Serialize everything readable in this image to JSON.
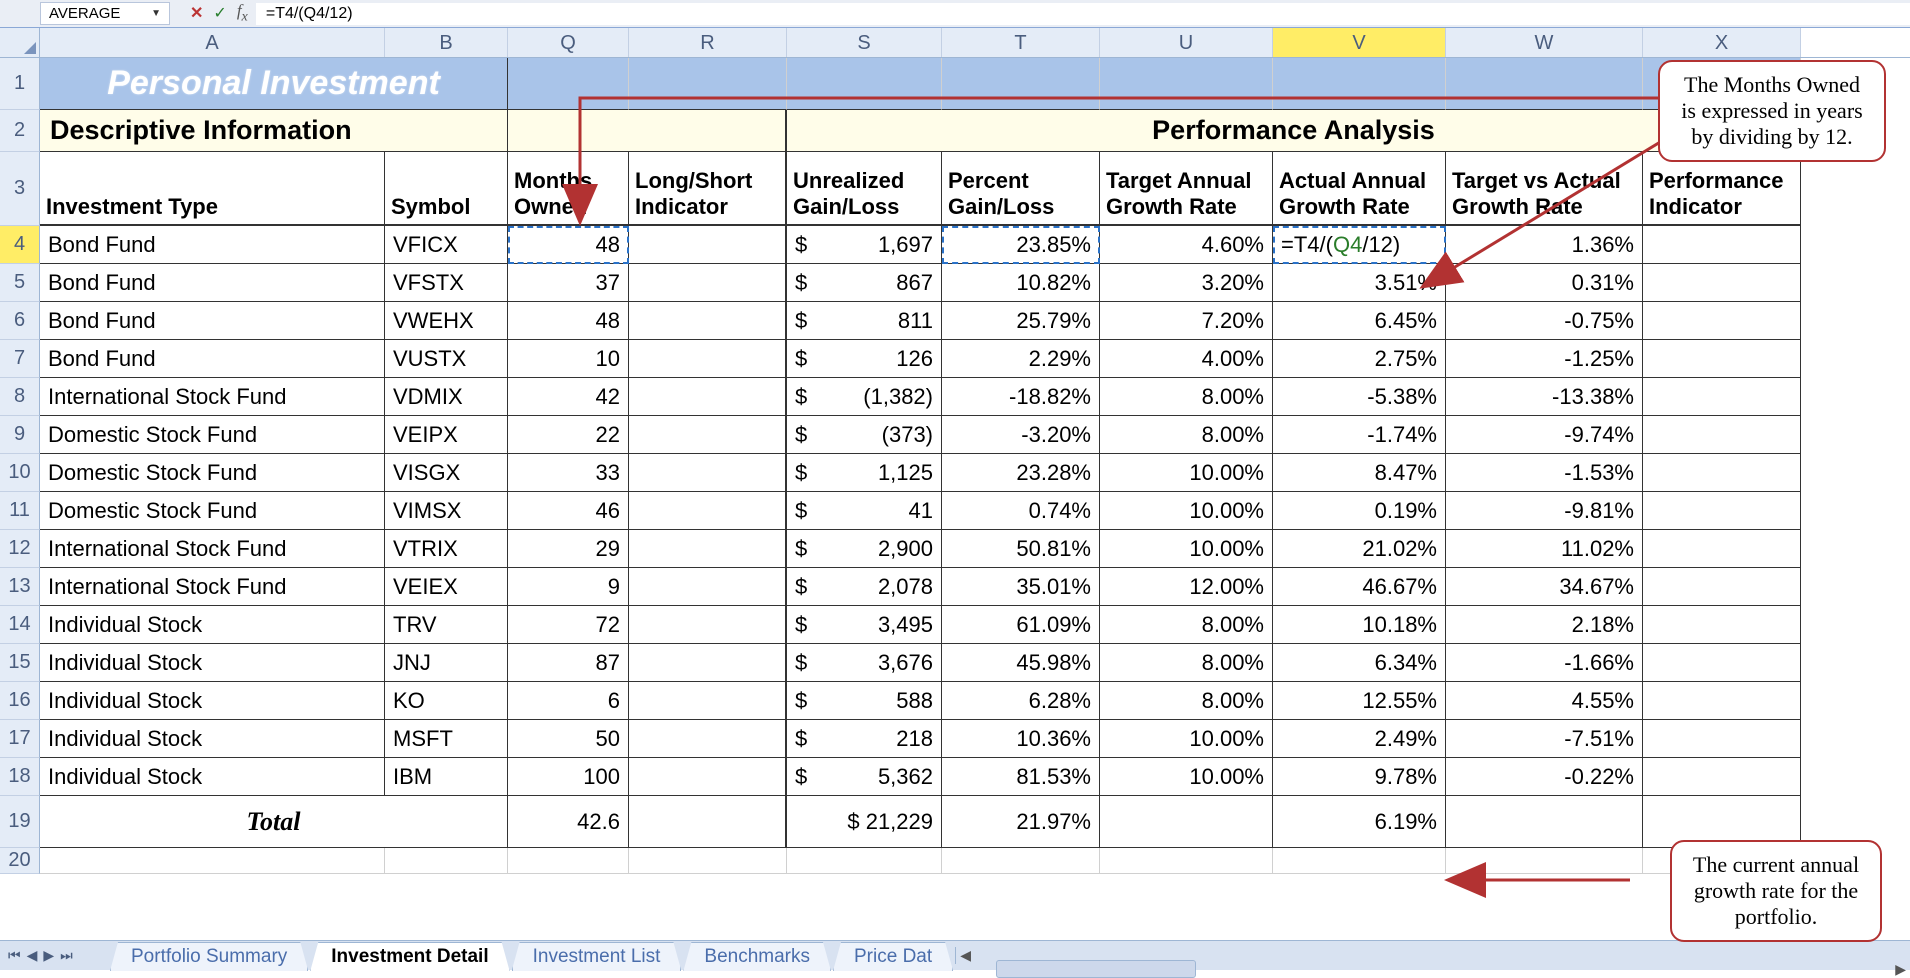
{
  "formula_bar": {
    "name_box": "AVERAGE",
    "formula": "=T4/(Q4/12)"
  },
  "app_title": "Personal Investment",
  "section1": "Descriptive Information",
  "section2": "Performance Analysis",
  "columns": {
    "A": "A",
    "B": "B",
    "Q": "Q",
    "R": "R",
    "S": "S",
    "T": "T",
    "U": "U",
    "V": "V",
    "W": "W",
    "X": "X"
  },
  "headers": {
    "inv_type": "Investment Type",
    "symbol": "Symbol",
    "months": "Months Owned",
    "longshort": "Long/Short Indicator",
    "unreal": "Unrealized Gain/Loss",
    "pct": "Percent Gain/Loss",
    "target": "Target Annual Growth Rate",
    "actual": "Actual Annual Growth Rate",
    "tva": "Target vs Actual Growth Rate",
    "perf": "Performance Indicator"
  },
  "edit_formula": "=T4/(Q4/12)",
  "rows": [
    {
      "n": 4,
      "type": "Bond Fund",
      "sym": "VFICX",
      "months": "48",
      "gl": "1,697",
      "pct": "23.85%",
      "tgt": "4.60%",
      "act": "",
      "tva": "1.36%"
    },
    {
      "n": 5,
      "type": "Bond Fund",
      "sym": "VFSTX",
      "months": "37",
      "gl": "867",
      "pct": "10.82%",
      "tgt": "3.20%",
      "act": "3.51%",
      "tva": "0.31%"
    },
    {
      "n": 6,
      "type": "Bond Fund",
      "sym": "VWEHX",
      "months": "48",
      "gl": "811",
      "pct": "25.79%",
      "tgt": "7.20%",
      "act": "6.45%",
      "tva": "-0.75%"
    },
    {
      "n": 7,
      "type": "Bond Fund",
      "sym": "VUSTX",
      "months": "10",
      "gl": "126",
      "pct": "2.29%",
      "tgt": "4.00%",
      "act": "2.75%",
      "tva": "-1.25%"
    },
    {
      "n": 8,
      "type": "International Stock Fund",
      "sym": "VDMIX",
      "months": "42",
      "gl": "(1,382)",
      "pct": "-18.82%",
      "tgt": "8.00%",
      "act": "-5.38%",
      "tva": "-13.38%"
    },
    {
      "n": 9,
      "type": "Domestic Stock Fund",
      "sym": "VEIPX",
      "months": "22",
      "gl": "(373)",
      "pct": "-3.20%",
      "tgt": "8.00%",
      "act": "-1.74%",
      "tva": "-9.74%"
    },
    {
      "n": 10,
      "type": "Domestic Stock Fund",
      "sym": "VISGX",
      "months": "33",
      "gl": "1,125",
      "pct": "23.28%",
      "tgt": "10.00%",
      "act": "8.47%",
      "tva": "-1.53%"
    },
    {
      "n": 11,
      "type": "Domestic Stock Fund",
      "sym": "VIMSX",
      "months": "46",
      "gl": "41",
      "pct": "0.74%",
      "tgt": "10.00%",
      "act": "0.19%",
      "tva": "-9.81%"
    },
    {
      "n": 12,
      "type": "International Stock Fund",
      "sym": "VTRIX",
      "months": "29",
      "gl": "2,900",
      "pct": "50.81%",
      "tgt": "10.00%",
      "act": "21.02%",
      "tva": "11.02%"
    },
    {
      "n": 13,
      "type": "International Stock Fund",
      "sym": "VEIEX",
      "months": "9",
      "gl": "2,078",
      "pct": "35.01%",
      "tgt": "12.00%",
      "act": "46.67%",
      "tva": "34.67%"
    },
    {
      "n": 14,
      "type": "Individual Stock",
      "sym": "TRV",
      "months": "72",
      "gl": "3,495",
      "pct": "61.09%",
      "tgt": "8.00%",
      "act": "10.18%",
      "tva": "2.18%"
    },
    {
      "n": 15,
      "type": "Individual Stock",
      "sym": "JNJ",
      "months": "87",
      "gl": "3,676",
      "pct": "45.98%",
      "tgt": "8.00%",
      "act": "6.34%",
      "tva": "-1.66%"
    },
    {
      "n": 16,
      "type": "Individual Stock",
      "sym": "KO",
      "months": "6",
      "gl": "588",
      "pct": "6.28%",
      "tgt": "8.00%",
      "act": "12.55%",
      "tva": "4.55%"
    },
    {
      "n": 17,
      "type": "Individual Stock",
      "sym": "MSFT",
      "months": "50",
      "gl": "218",
      "pct": "10.36%",
      "tgt": "10.00%",
      "act": "2.49%",
      "tva": "-7.51%"
    },
    {
      "n": 18,
      "type": "Individual Stock",
      "sym": "IBM",
      "months": "100",
      "gl": "5,362",
      "pct": "81.53%",
      "tgt": "10.00%",
      "act": "9.78%",
      "tva": "-0.22%"
    }
  ],
  "total": {
    "n": 19,
    "label": "Total",
    "months": "42.6",
    "gl": "$ 21,229",
    "pct": "21.97%",
    "act": "6.19%"
  },
  "row20": "20",
  "tabs": [
    "Portfolio Summary",
    "Investment Detail",
    "Investment List",
    "Benchmarks",
    "Price Dat"
  ],
  "callout1": "The Months Owned is expressed in years by dividing by 12.",
  "callout2": "The current annual growth rate for the portfolio."
}
